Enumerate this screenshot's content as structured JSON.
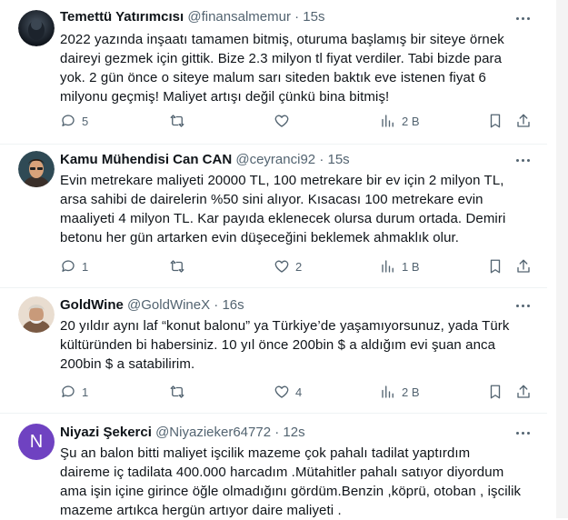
{
  "tweets": [
    {
      "name": "Temettü Yatırımcısı",
      "handle": "@finansalmemur",
      "time": "15s",
      "avatar_initial": "",
      "text": "2022 yazında inşaatı tamamen bitmiş, oturuma başlamış bir siteye örnek\ndaireyi gezmek için gittik. Bize 2.3 milyon tl fiyat verdiler. Tabi bizde para\nyok. 2 gün önce o siteye malum sarı siteden baktık eve istenen fiyat 6\nmilyonu geçmiş! Maliyet artışı değil çünkü bina bitmiş!",
      "replies": "5",
      "retweets": "",
      "likes": "",
      "views": "2 B"
    },
    {
      "name": "Kamu Mühendisi Can CAN",
      "handle": "@ceyranci92",
      "time": "15s",
      "avatar_initial": "",
      "text": "Evin metrekare maliyeti 20000 TL, 100 metrekare bir ev için 2 milyon TL,\narsa sahibi de dairelerin %50 sini alıyor. Kısacası 100 metrekare evin\nmaaliyeti 4 milyon TL. Kar payıda eklenecek olursa durum ortada. Demiri\nbetonu her gün artarken evin düşeceğini beklemek ahmaklık olur.",
      "replies": "1",
      "retweets": "",
      "likes": "2",
      "views": "1 B"
    },
    {
      "name": "GoldWine",
      "handle": "@GoldWineX",
      "time": "16s",
      "avatar_initial": "",
      "text": "20 yıldır aynı laf “konut balonu” ya Türkiye’de yaşamıyorsunuz, yada Türk\nkültüründen bi habersiniz. 10 yıl önce 200bin $ a aldığım evi şuan anca\n200bin $ a satabilirim.",
      "replies": "1",
      "retweets": "",
      "likes": "4",
      "views": "2 B"
    },
    {
      "name": "Niyazi Şekerci",
      "handle": "@Niyazieker64772",
      "time": "12s",
      "avatar_initial": "N",
      "text": "Şu an balon bitti maliyet işcilik mazeme çok pahalı tadilat yaptırdım\ndaireme iç tadilata 400.000 harcadım .Mütahitler pahalı satıyor diyordum\nama işin içine girince öğle olmadığını gördüm.Benzin ,köprü, otoban , işcilik\nmazeme artıkca  hergün artıyor daire maliyeti .",
      "replies": "",
      "retweets": "",
      "likes": "",
      "views": ""
    }
  ],
  "colors": {
    "text": "#0f1419",
    "muted": "#536471",
    "avatar4": "#6f42c1"
  },
  "icons": [
    "reply-icon",
    "retweet-icon",
    "like-icon",
    "views-icon",
    "bookmark-icon",
    "share-icon",
    "more-icon"
  ]
}
